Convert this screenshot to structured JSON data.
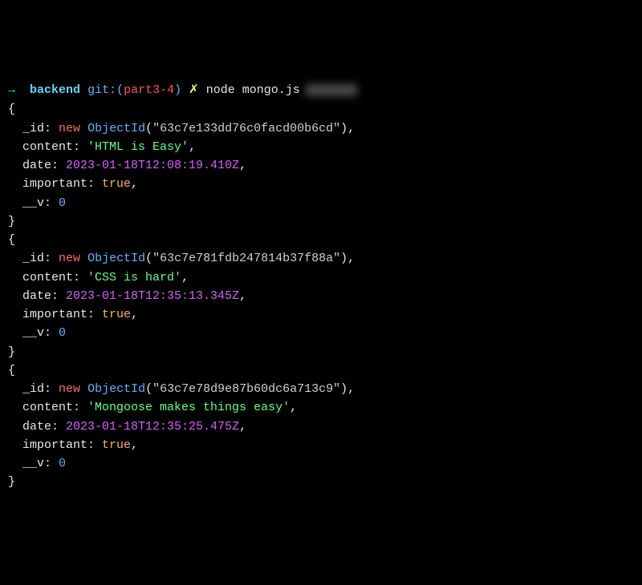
{
  "prompt": {
    "arrow": "→",
    "dir": "backend",
    "git_label": "git:(",
    "branch": "part3-4",
    "git_close": ")",
    "dirty": "✗",
    "command": "node mongo.js"
  },
  "objects": [
    {
      "id": "63c7e133dd76c0facd00b6cd",
      "content": "HTML is Easy",
      "date": "2023-01-18T12:08:19.410Z",
      "important": "true",
      "v": "0"
    },
    {
      "id": "63c7e781fdb247814b37f88a",
      "content": "CSS is hard",
      "date": "2023-01-18T12:35:13.345Z",
      "important": "true",
      "v": "0"
    },
    {
      "id": "63c7e78d9e87b60dc6a713c9",
      "content": "Mongoose makes things easy",
      "date": "2023-01-18T12:35:25.475Z",
      "important": "true",
      "v": "0"
    }
  ],
  "labels": {
    "id_key": "_id:",
    "new_kw": "new",
    "objectid": "ObjectId",
    "content_key": "content:",
    "date_key": "date:",
    "important_key": "important:",
    "v_key": "__v:",
    "open_brace": "{",
    "close_brace": "}",
    "comma": ","
  }
}
